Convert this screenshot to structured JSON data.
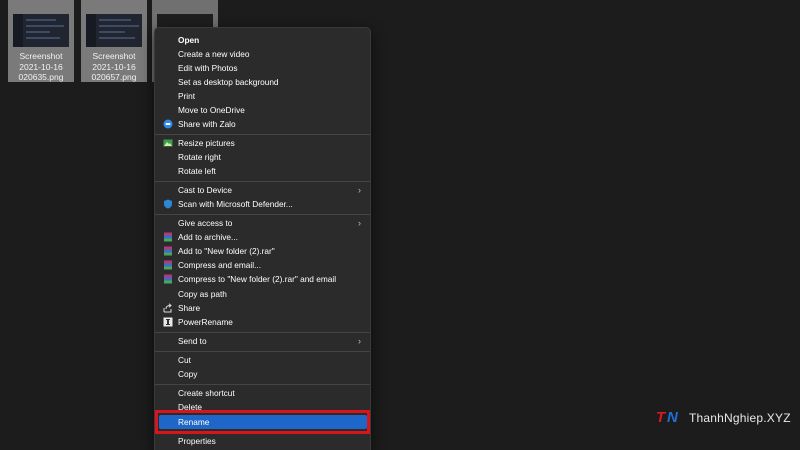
{
  "desktop": {
    "files": [
      {
        "line1": "Screenshot",
        "line2": "2021-10-16",
        "line3": "020635.png"
      },
      {
        "line1": "Screenshot",
        "line2": "2021-10-16",
        "line3": "020657.png"
      },
      {
        "line1": "",
        "line2": "",
        "line3": ""
      }
    ]
  },
  "menu": {
    "open": "Open",
    "create_video": "Create a new video",
    "edit_photos": "Edit with Photos",
    "set_background": "Set as desktop background",
    "print": "Print",
    "move_onedrive": "Move to OneDrive",
    "share_zalo": "Share with Zalo",
    "resize_pictures": "Resize pictures",
    "rotate_right": "Rotate right",
    "rotate_left": "Rotate left",
    "cast_device": "Cast to Device",
    "scan_defender": "Scan with Microsoft Defender...",
    "give_access": "Give access to",
    "add_archive": "Add to archive...",
    "add_rar": "Add to \"New folder (2).rar\"",
    "compress_email": "Compress and email...",
    "compress_rar_email": "Compress to \"New folder (2).rar\" and email",
    "copy_path": "Copy as path",
    "share": "Share",
    "powerrename": "PowerRename",
    "send_to": "Send to",
    "cut": "Cut",
    "copy": "Copy",
    "create_shortcut": "Create shortcut",
    "delete": "Delete",
    "rename": "Rename",
    "properties": "Properties",
    "chevron": "›"
  },
  "icons": {
    "zalo": "zalo-icon",
    "resize": "image-resizer-icon",
    "defender": "defender-shield-icon",
    "winrar": "winrar-icon",
    "share": "share-icon",
    "powerrename": "powerrename-icon"
  },
  "colors": {
    "selection": "#1e66c7",
    "highlight_box": "#d9141b",
    "menu_bg": "#2b2b2b"
  },
  "watermark": {
    "logo_t": "T",
    "logo_n": "N",
    "text": "ThanhNghiep.XYZ"
  }
}
